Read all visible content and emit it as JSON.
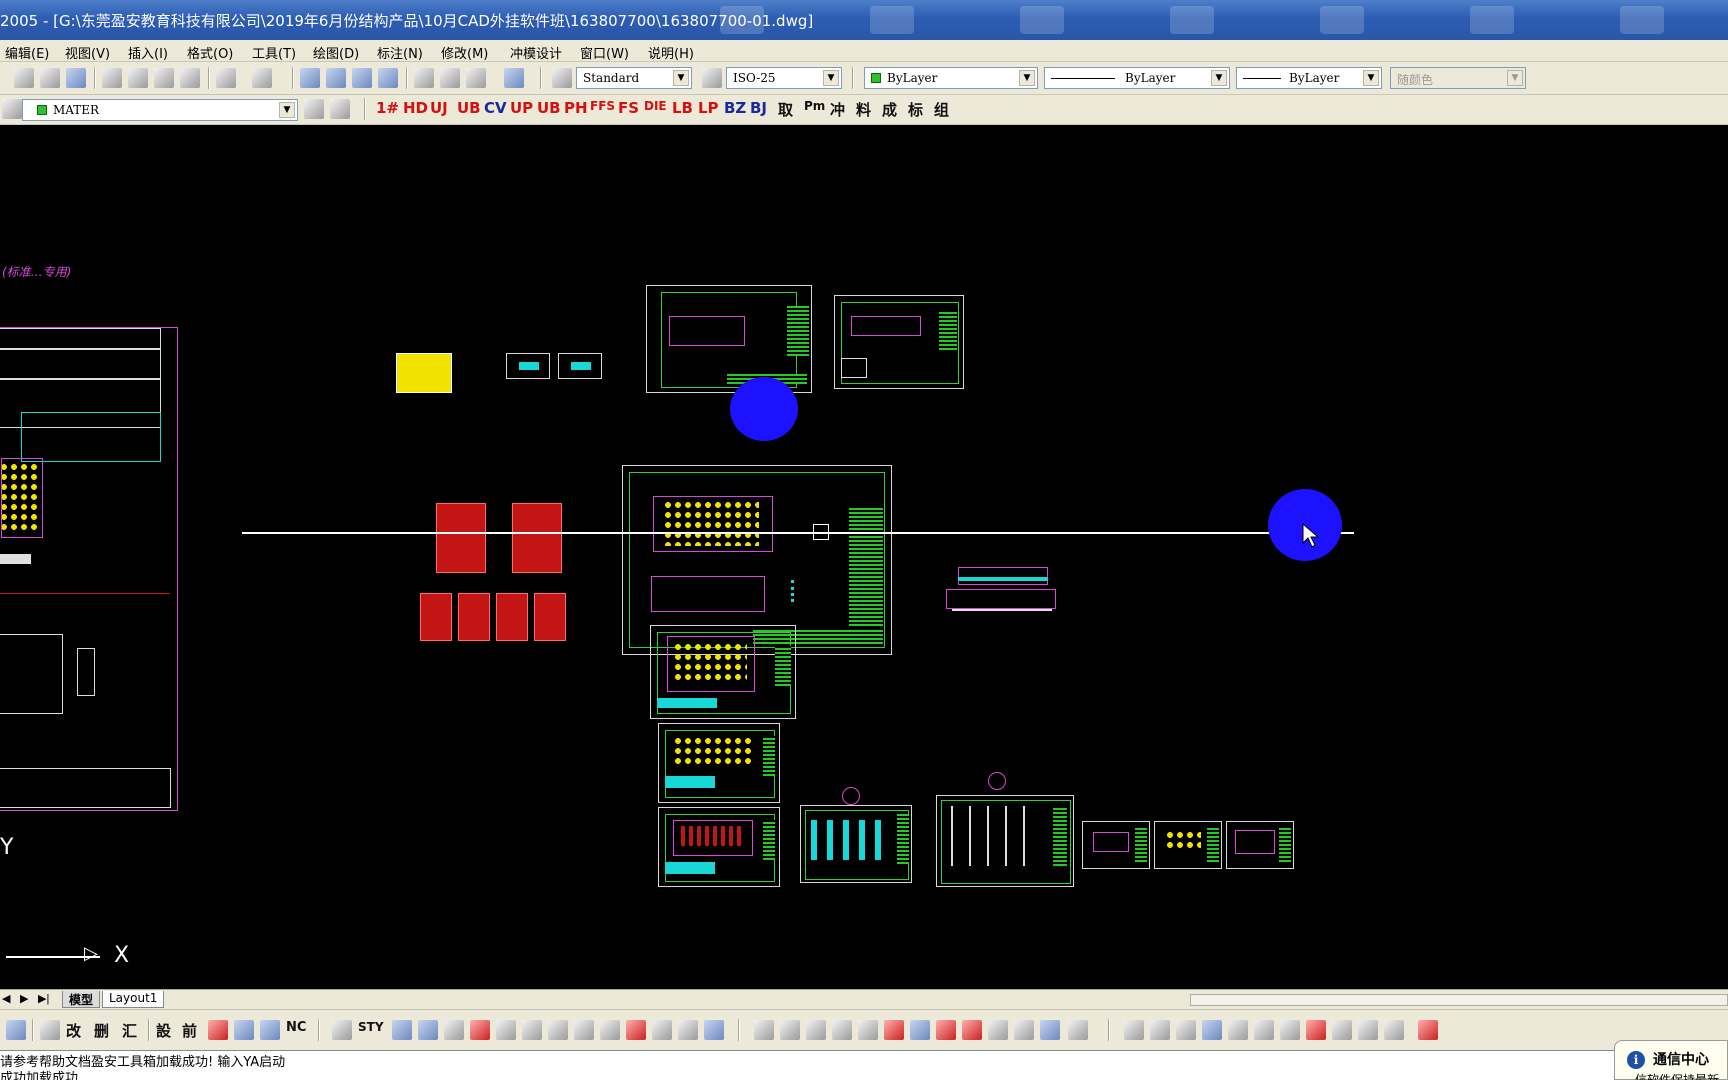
{
  "window": {
    "title": "2005 - [G:\\东莞盈安教育科技有限公司\\2019年6月份结构产品\\10月CAD外挂软件班\\163807700\\163807700-01.dwg]"
  },
  "menu": [
    "编辑(E)",
    "视图(V)",
    "插入(I)",
    "格式(O)",
    "工具(T)",
    "绘图(D)",
    "标注(N)",
    "修改(M)",
    "冲模设计",
    "窗口(W)",
    "说明(H)"
  ],
  "toolbar": {
    "text_style": "Standard",
    "dim_style": "ISO-25",
    "layer_color": "ByLayer",
    "linetype": "ByLayer",
    "lineweight": "ByLayer",
    "plot_style": "随颜色",
    "layer_name": "MATER"
  },
  "plugin_toolbar_top": [
    "1#",
    "HD",
    "UJ",
    "UB",
    "CV",
    "UP",
    "UB",
    "PH",
    "FFS",
    "FS",
    "DIE",
    "LB",
    "LP",
    "BZ",
    "BJ",
    "取",
    "Pm",
    "冲",
    "料",
    "成",
    "标",
    "组"
  ],
  "plugin_toolbar_bottom": [
    "改",
    "删",
    "汇",
    "設",
    "前",
    "NC",
    "STY"
  ],
  "drawing": {
    "left_title": "(标准…专用)",
    "ucs_x": "X",
    "ucs_y": "Y"
  },
  "tabs": [
    "模型",
    "Layout1"
  ],
  "command_line": {
    "line1": "请参考帮助文档盈安工具箱加载成功! 输入YA启动",
    "line2": "成功加载成功"
  },
  "comm_center": {
    "label": "通信中心",
    "sub": "信软件保持最新"
  },
  "colors": {
    "title_bar": "#2d5db4",
    "toolbar_bg": "#ece9d8",
    "canvas_bg": "#000000",
    "highlight_dot": "#1d12ff",
    "sheet_green": "#2fd22f",
    "part_red": "#c41515"
  }
}
